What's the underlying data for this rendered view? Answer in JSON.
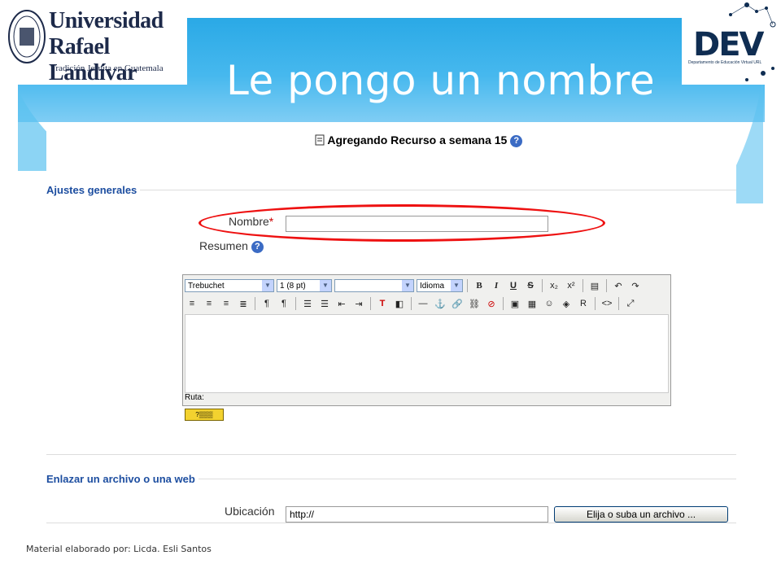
{
  "slide": {
    "title": "Le pongo un nombre",
    "footer": "Material elaborado por: Licda. Esli Santos",
    "colors": {
      "banner": "#2aa9e6",
      "highlight_oval": "#e11111"
    }
  },
  "logos": {
    "university_line1": "Universidad",
    "university_line2": "Rafael Landívar",
    "university_tagline": "Tradición Jesuita en Guatemala",
    "dev_text": "DEV",
    "dev_subtitle": "Departamento de Educación Virtual URL"
  },
  "form": {
    "heading": "Agregando Recurso a semana 15",
    "general_legend": "Ajustes generales",
    "name_label": "Nombre",
    "name_required": "*",
    "name_value": "",
    "summary_label": "Resumen",
    "editor": {
      "font_family": "Trebuchet",
      "font_size": "1 (8 pt)",
      "format": "",
      "language": "Idioma",
      "path_label": "Ruta:"
    },
    "link_legend": "Enlazar un archivo o una web",
    "location_label": "Ubicación",
    "location_value": "http://",
    "choose_button": "Elija o suba un archivo ..."
  }
}
